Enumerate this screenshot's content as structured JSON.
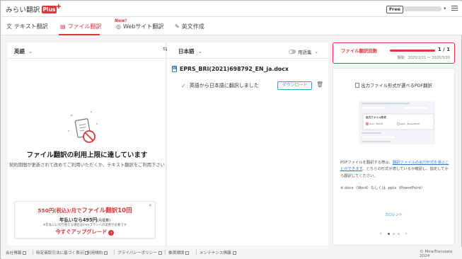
{
  "header": {
    "logo_text": "みらい翻訳",
    "logo_plus": "Plus",
    "plan": "Free"
  },
  "nav": {
    "tabs": [
      {
        "label": "テキスト翻訳",
        "icon": "text-translate-icon"
      },
      {
        "label": "ファイル翻訳",
        "icon": "file-translate-icon",
        "active": true
      },
      {
        "label": "Webサイト翻訳",
        "icon": "web-translate-icon"
      },
      {
        "label": "英文作成",
        "icon": "compose-icon"
      }
    ],
    "new_badge": "New!"
  },
  "left": {
    "source_lang": "英語",
    "limit_title": "ファイル翻訳の利用上限に達しています",
    "limit_sub": "契約期間が更新されて改めてご利用いただくか、テキスト翻訳をご利用下さい",
    "promo": {
      "line1_a": "550円(税込)/月で",
      "line1_b": "ファイル翻訳10回",
      "line2_a": "年払いなら495円",
      "line2_b": "(月換算)",
      "line3": "※年払いに切り替える場合はFreeプランへの変更が必要です",
      "cta": "今すぐアップグレード"
    }
  },
  "middle": {
    "target_lang": "日本語",
    "glossary": "用語集",
    "file_name": "EPRS_BRI(2021)698792_EN_ja.docx",
    "status": "英語から日本語に翻訳しました",
    "download": "ダウンロード"
  },
  "usage": {
    "label": "ファイル翻訳回数",
    "count": "1 / 1",
    "fraction": 1.0,
    "period": "期間：2025/2/21 ～ 2025/3/20"
  },
  "info": {
    "title": "出力ファイル形式が選べるPDF翻訳",
    "mock_heading": "出力ファイル形式",
    "mock_opt1": "docx（Word）",
    "mock_opt2": "pptx（PowerPoint）",
    "text_a": "PDFファイルを翻訳する際は、",
    "text_link": "翻訳ファイルの出力形式を選ぶことができます",
    "text_b": "。どちらの形式が適しているか確認し、指定してから翻訳してください。",
    "text2": "※.docx（Word）もしくは .pptx（PowerPoint）",
    "carousel_label": "カロレント"
  },
  "footer": {
    "links": [
      "会社情報",
      "特定商取引法に基づく表示",
      "利用規約",
      "プライバシーポリシー",
      "推奨環境",
      "メンテナンス情報"
    ],
    "copyright": "© MiraiTranslate 2024"
  },
  "colors": {
    "accent": "#d9383f",
    "link": "#2a7fd3",
    "download": "#2fa6c7",
    "success": "#3aa35c"
  }
}
